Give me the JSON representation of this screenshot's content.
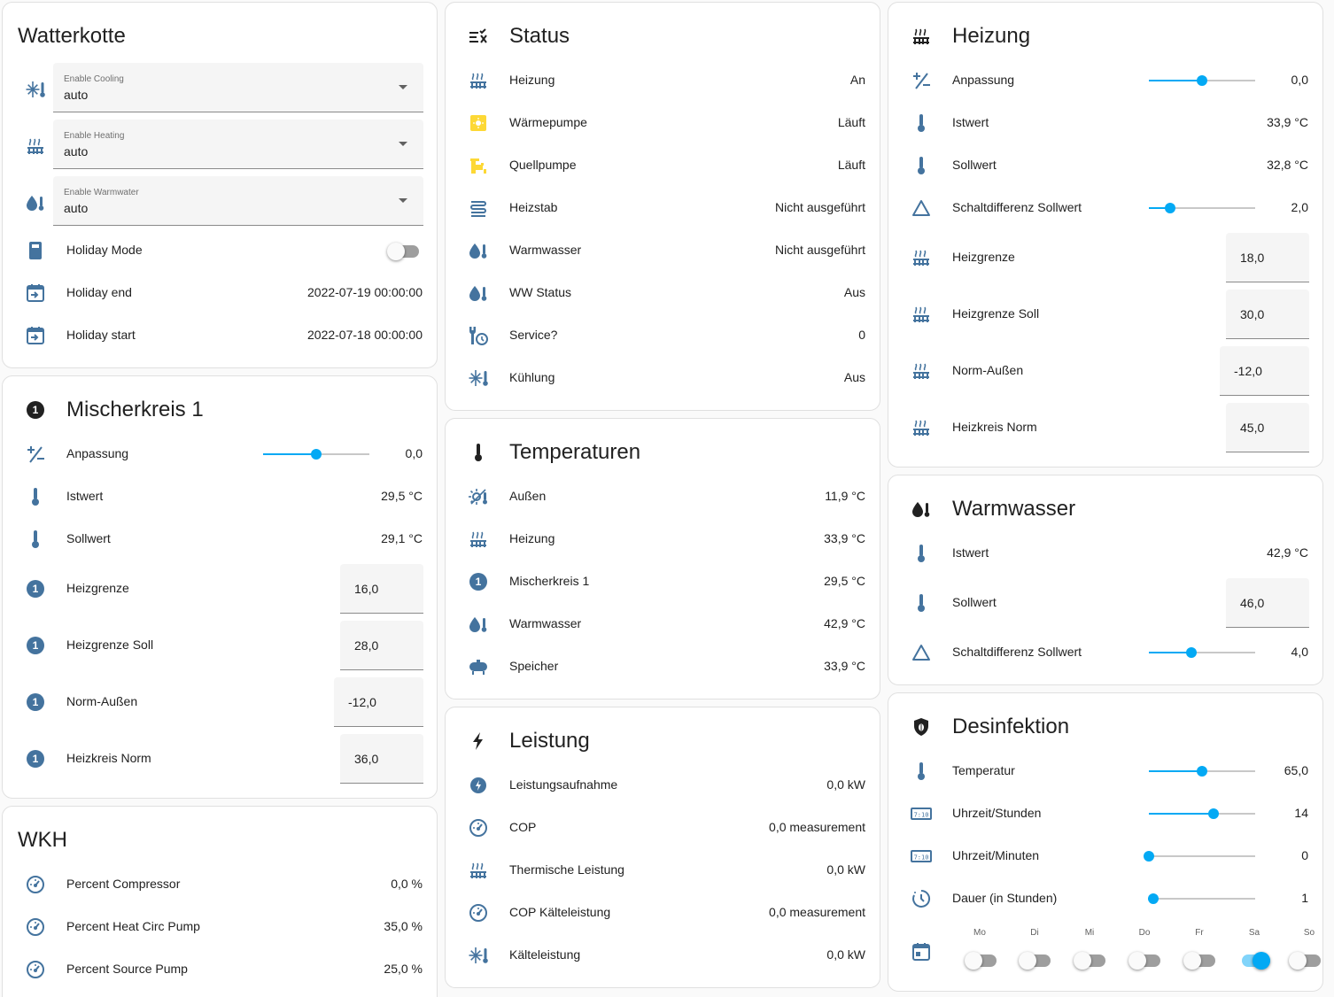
{
  "watterkotte": {
    "title": "Watterkotte",
    "selects": [
      {
        "label": "Enable Cooling",
        "value": "auto",
        "icon": "snowflake-thermometer-icon"
      },
      {
        "label": "Enable Heating",
        "value": "auto",
        "icon": "radiator-icon"
      },
      {
        "label": "Enable Warmwater",
        "value": "auto",
        "icon": "water-thermometer-icon"
      }
    ],
    "holiday_mode": {
      "label": "Holiday Mode",
      "on": false
    },
    "holiday_end": {
      "label": "Holiday end",
      "value": "2022-07-19 00:00:00"
    },
    "holiday_start": {
      "label": "Holiday start",
      "value": "2022-07-18 00:00:00"
    }
  },
  "mischerkreis": {
    "title": "Mischerkreis 1",
    "badge": "1",
    "anpassung": {
      "label": "Anpassung",
      "value": "0,0",
      "level": 0.5
    },
    "istwert": {
      "label": "Istwert",
      "value": "29,5 °C"
    },
    "sollwert": {
      "label": "Sollwert",
      "value": "29,1 °C"
    },
    "heizgrenze": {
      "label": "Heizgrenze",
      "value": "16,0"
    },
    "heizgrenze_soll": {
      "label": "Heizgrenze Soll",
      "value": "28,0"
    },
    "norm_aussen": {
      "label": "Norm-Außen",
      "value": "-12,0"
    },
    "heizkreis_norm": {
      "label": "Heizkreis Norm",
      "value": "36,0"
    }
  },
  "wkh": {
    "title": "WKH",
    "rows": [
      {
        "label": "Percent Compressor",
        "value": "0,0 %"
      },
      {
        "label": "Percent Heat Circ Pump",
        "value": "35,0 %"
      },
      {
        "label": "Percent Source Pump",
        "value": "25,0 %"
      }
    ]
  },
  "status": {
    "title": "Status",
    "rows": [
      {
        "label": "Heizung",
        "value": "An",
        "icon": "radiator-icon"
      },
      {
        "label": "Wärmepumpe",
        "value": "Läuft",
        "icon": "sun-icon"
      },
      {
        "label": "Quellpumpe",
        "value": "Läuft",
        "icon": "pump-icon"
      },
      {
        "label": "Heizstab",
        "value": "Nicht ausgeführt",
        "icon": "heating-rod-icon"
      },
      {
        "label": "Warmwasser",
        "value": "Nicht ausgeführt",
        "icon": "water-thermometer-icon"
      },
      {
        "label": "WW Status",
        "value": "Aus",
        "icon": "water-thermometer-icon"
      },
      {
        "label": "Service?",
        "value": "0",
        "icon": "wrench-clock-icon"
      },
      {
        "label": "Kühlung",
        "value": "Aus",
        "icon": "snowflake-thermometer-icon"
      }
    ]
  },
  "temperaturen": {
    "title": "Temperaturen",
    "rows": [
      {
        "label": "Außen",
        "value": "11,9 °C"
      },
      {
        "label": "Heizung",
        "value": "33,9 °C"
      },
      {
        "label": "Mischerkreis 1",
        "value": "29,5 °C"
      },
      {
        "label": "Warmwasser",
        "value": "42,9 °C"
      },
      {
        "label": "Speicher",
        "value": "33,9 °C"
      }
    ]
  },
  "leistung": {
    "title": "Leistung",
    "rows": [
      {
        "label": "Leistungsaufnahme",
        "value": "0,0 kW"
      },
      {
        "label": "COP",
        "value": "0,0 measurement"
      },
      {
        "label": "Thermische Leistung",
        "value": "0,0 kW"
      },
      {
        "label": "COP Kälteleistung",
        "value": "0,0 measurement"
      },
      {
        "label": "Kälteleistung",
        "value": "0,0 kW"
      }
    ]
  },
  "heizung": {
    "title": "Heizung",
    "anpassung": {
      "label": "Anpassung",
      "value": "0,0",
      "level": 0.5
    },
    "istwert": {
      "label": "Istwert",
      "value": "33,9 °C"
    },
    "sollwert": {
      "label": "Sollwert",
      "value": "32,8 °C"
    },
    "schaltdifferenz": {
      "label": "Schaltdifferenz Sollwert",
      "value": "2,0",
      "level": 0.2
    },
    "heizgrenze": {
      "label": "Heizgrenze",
      "value": "18,0"
    },
    "heizgrenze_soll": {
      "label": "Heizgrenze Soll",
      "value": "30,0"
    },
    "norm_aussen": {
      "label": "Norm-Außen",
      "value": "-12,0"
    },
    "heizkreis_norm": {
      "label": "Heizkreis Norm",
      "value": "45,0"
    }
  },
  "warmwasser": {
    "title": "Warmwasser",
    "istwert": {
      "label": "Istwert",
      "value": "42,9 °C"
    },
    "sollwert": {
      "label": "Sollwert",
      "value": "46,0"
    },
    "schaltdifferenz": {
      "label": "Schaltdifferenz Sollwert",
      "value": "4,0",
      "level": 0.4
    }
  },
  "desinfektion": {
    "title": "Desinfektion",
    "temperatur": {
      "label": "Temperatur",
      "value": "65,0",
      "level": 0.5
    },
    "stunden": {
      "label": "Uhrzeit/Stunden",
      "value": "14",
      "level": 0.61
    },
    "minuten": {
      "label": "Uhrzeit/Minuten",
      "value": "0",
      "level": 0.0
    },
    "dauer": {
      "label": "Dauer (in Stunden)",
      "value": "1",
      "level": 0.04
    },
    "days": [
      {
        "label": "Mo",
        "on": false
      },
      {
        "label": "Di",
        "on": false
      },
      {
        "label": "Mi",
        "on": false
      },
      {
        "label": "Do",
        "on": false
      },
      {
        "label": "Fr",
        "on": false
      },
      {
        "label": "Sa",
        "on": true
      },
      {
        "label": "So",
        "on": false
      }
    ]
  },
  "colors": {
    "accent": "#03a9f4",
    "icon": "#44739e",
    "active_icon": "#fdd835"
  }
}
